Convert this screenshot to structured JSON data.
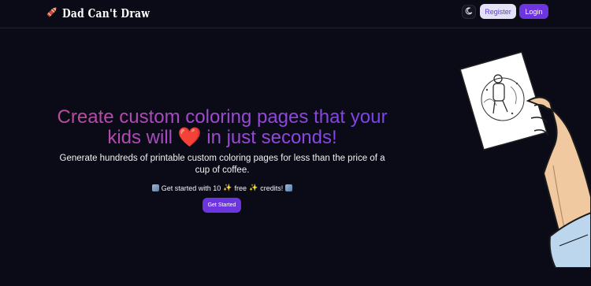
{
  "nav": {
    "brand": "Dad Can't Draw",
    "brand_icon": "crayon-icon",
    "theme_icon": "moon-icon",
    "register_label": "Register",
    "login_label": "Login"
  },
  "hero": {
    "headline_part1": "Create custom coloring pages that your kids will",
    "headline_heart": "❤️",
    "headline_part2": "in just seconds!",
    "subtitle": "Generate hundreds of printable custom coloring pages for less than the price of a cup of coffee.",
    "credits_prefix": "Get started with 10",
    "credits_free": "free",
    "credits_suffix": "credits!",
    "cta_label": "Get Started"
  },
  "colors": {
    "background": "#0b0b17",
    "accent": "#6d35e0",
    "register_bg": "#e3e0f7",
    "gradient_start": "#c14a9a",
    "gradient_end": "#7a43ec"
  }
}
